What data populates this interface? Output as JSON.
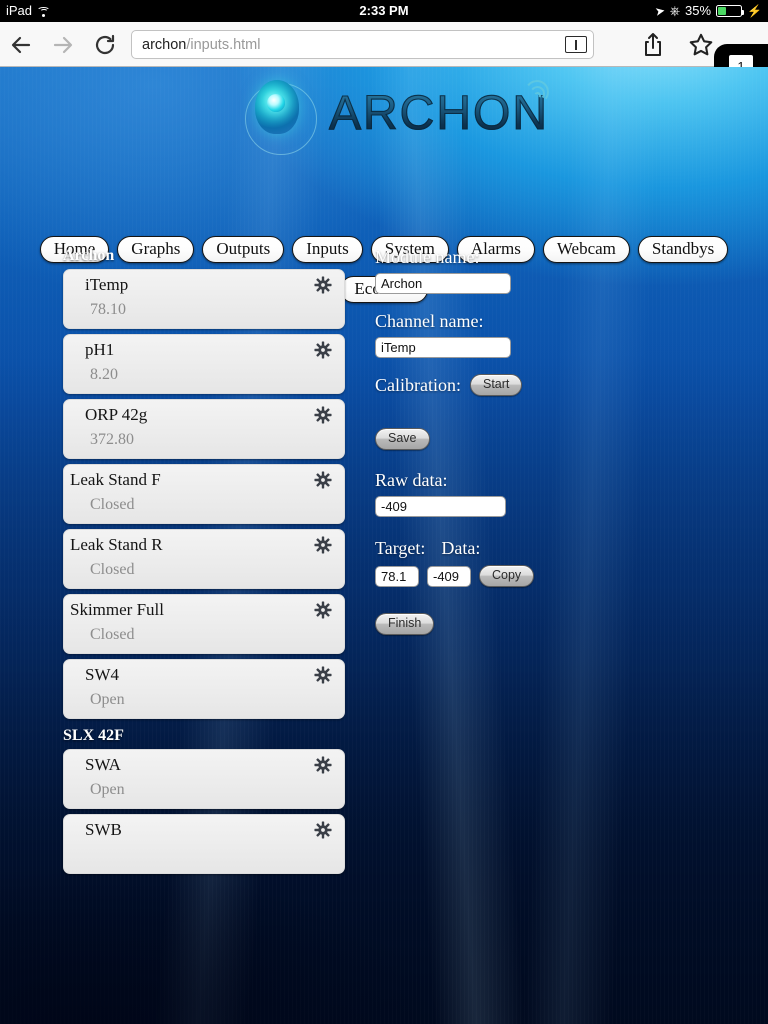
{
  "status_bar": {
    "carrier": "iPad",
    "wifi_icon": "wifi-icon",
    "time": "2:33 PM",
    "location_icon": "location-arrow-icon",
    "bluetooth_icon": "bluetooth-icon",
    "battery_percent": "35%",
    "battery_level": 35,
    "charging_icon": "lightning-bolt-icon",
    "battery_color": "#4cd964"
  },
  "browser": {
    "back_icon": "back-arrow-icon",
    "forward_icon": "forward-arrow-icon",
    "reload_icon": "reload-icon",
    "url_host": "archon",
    "url_path": "/inputs.html",
    "reader_icon": "reader-view-icon",
    "share_icon": "share-icon",
    "bookmark_icon": "bookmark-star-icon",
    "tab_count": "1"
  },
  "site": {
    "logo_text": "ARCHON",
    "logo_icon": "archon-logo-icon",
    "logo_signal_icon": "signal-waves-icon"
  },
  "nav": {
    "row1": [
      {
        "label": "Home"
      },
      {
        "label": "Graphs"
      },
      {
        "label": "Outputs"
      },
      {
        "label": "Inputs"
      },
      {
        "label": "System"
      },
      {
        "label": "Alarms"
      },
      {
        "label": "Webcam"
      },
      {
        "label": "Standbys"
      }
    ],
    "row2": [
      {
        "label": "EcoTech"
      }
    ]
  },
  "groups": [
    {
      "header": "Archon",
      "items": [
        {
          "name": "iTemp",
          "value": "78.10",
          "indent": true,
          "gear": "gear-icon"
        },
        {
          "name": "pH1",
          "value": "8.20",
          "indent": true,
          "gear": "gear-icon"
        },
        {
          "name": "ORP 42g",
          "value": "372.80",
          "indent": true,
          "gear": "gear-icon"
        },
        {
          "name": "Leak Stand F",
          "value": "Closed",
          "indent": false,
          "gear": "gear-icon"
        },
        {
          "name": "Leak Stand R",
          "value": "Closed",
          "indent": false,
          "gear": "gear-icon"
        },
        {
          "name": "Skimmer Full",
          "value": "Closed",
          "indent": false,
          "gear": "gear-icon"
        },
        {
          "name": "SW4",
          "value": "Open",
          "indent": true,
          "gear": "gear-icon"
        }
      ]
    },
    {
      "header": "SLX 42F",
      "items": [
        {
          "name": "SWA",
          "value": "Open",
          "indent": true,
          "gear": "gear-icon"
        },
        {
          "name": "SWB",
          "value": "",
          "indent": true,
          "gear": "gear-icon"
        }
      ]
    }
  ],
  "form": {
    "module_label": "Module name:",
    "module_value": "Archon",
    "channel_label": "Channel name:",
    "channel_value": "iTemp",
    "calibration_label": "Calibration:",
    "start_button": "Start",
    "save_button": "Save",
    "raw_data_label": "Raw data:",
    "raw_data_value": "-409",
    "target_label": "Target:",
    "data_label": "Data:",
    "target_value": "78.1",
    "data_value": "-409",
    "copy_button": "Copy",
    "finish_button": "Finish"
  }
}
